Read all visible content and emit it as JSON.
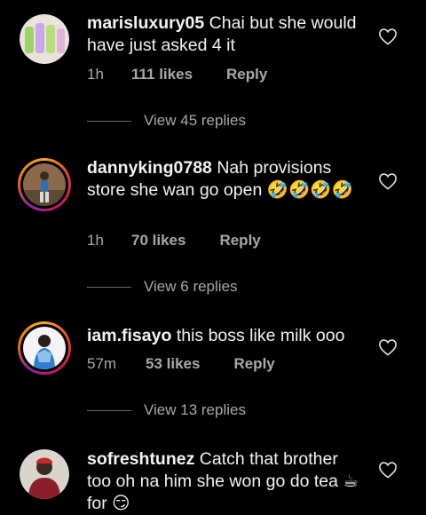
{
  "comments": [
    {
      "username": "marisluxury05",
      "text": "Chai but she would have just asked 4 it",
      "time": "1h",
      "likes": "111 likes",
      "reply": "Reply",
      "view_replies": "View 45 replies"
    },
    {
      "username": "dannyking0788",
      "text": "Nah provisions store she wan go open 🤣🤣🤣🤣",
      "time": "1h",
      "likes": "70 likes",
      "reply": "Reply",
      "view_replies": "View 6 replies"
    },
    {
      "username": "iam.fisayo",
      "text": "this boss like milk ooo",
      "time": "57m",
      "likes": "53 likes",
      "reply": "Reply",
      "view_replies": "View 13 replies"
    },
    {
      "username": "sofreshtunez",
      "text": "Catch that brother too oh na him she won go do tea ☕ for 😏",
      "time": "",
      "likes": "",
      "reply": "",
      "view_replies": ""
    }
  ],
  "icons": {
    "like": "heart-outline-icon"
  },
  "colors": {
    "background": "#000000",
    "text": "#f2f2f2",
    "meta": "#a8a8a8"
  }
}
